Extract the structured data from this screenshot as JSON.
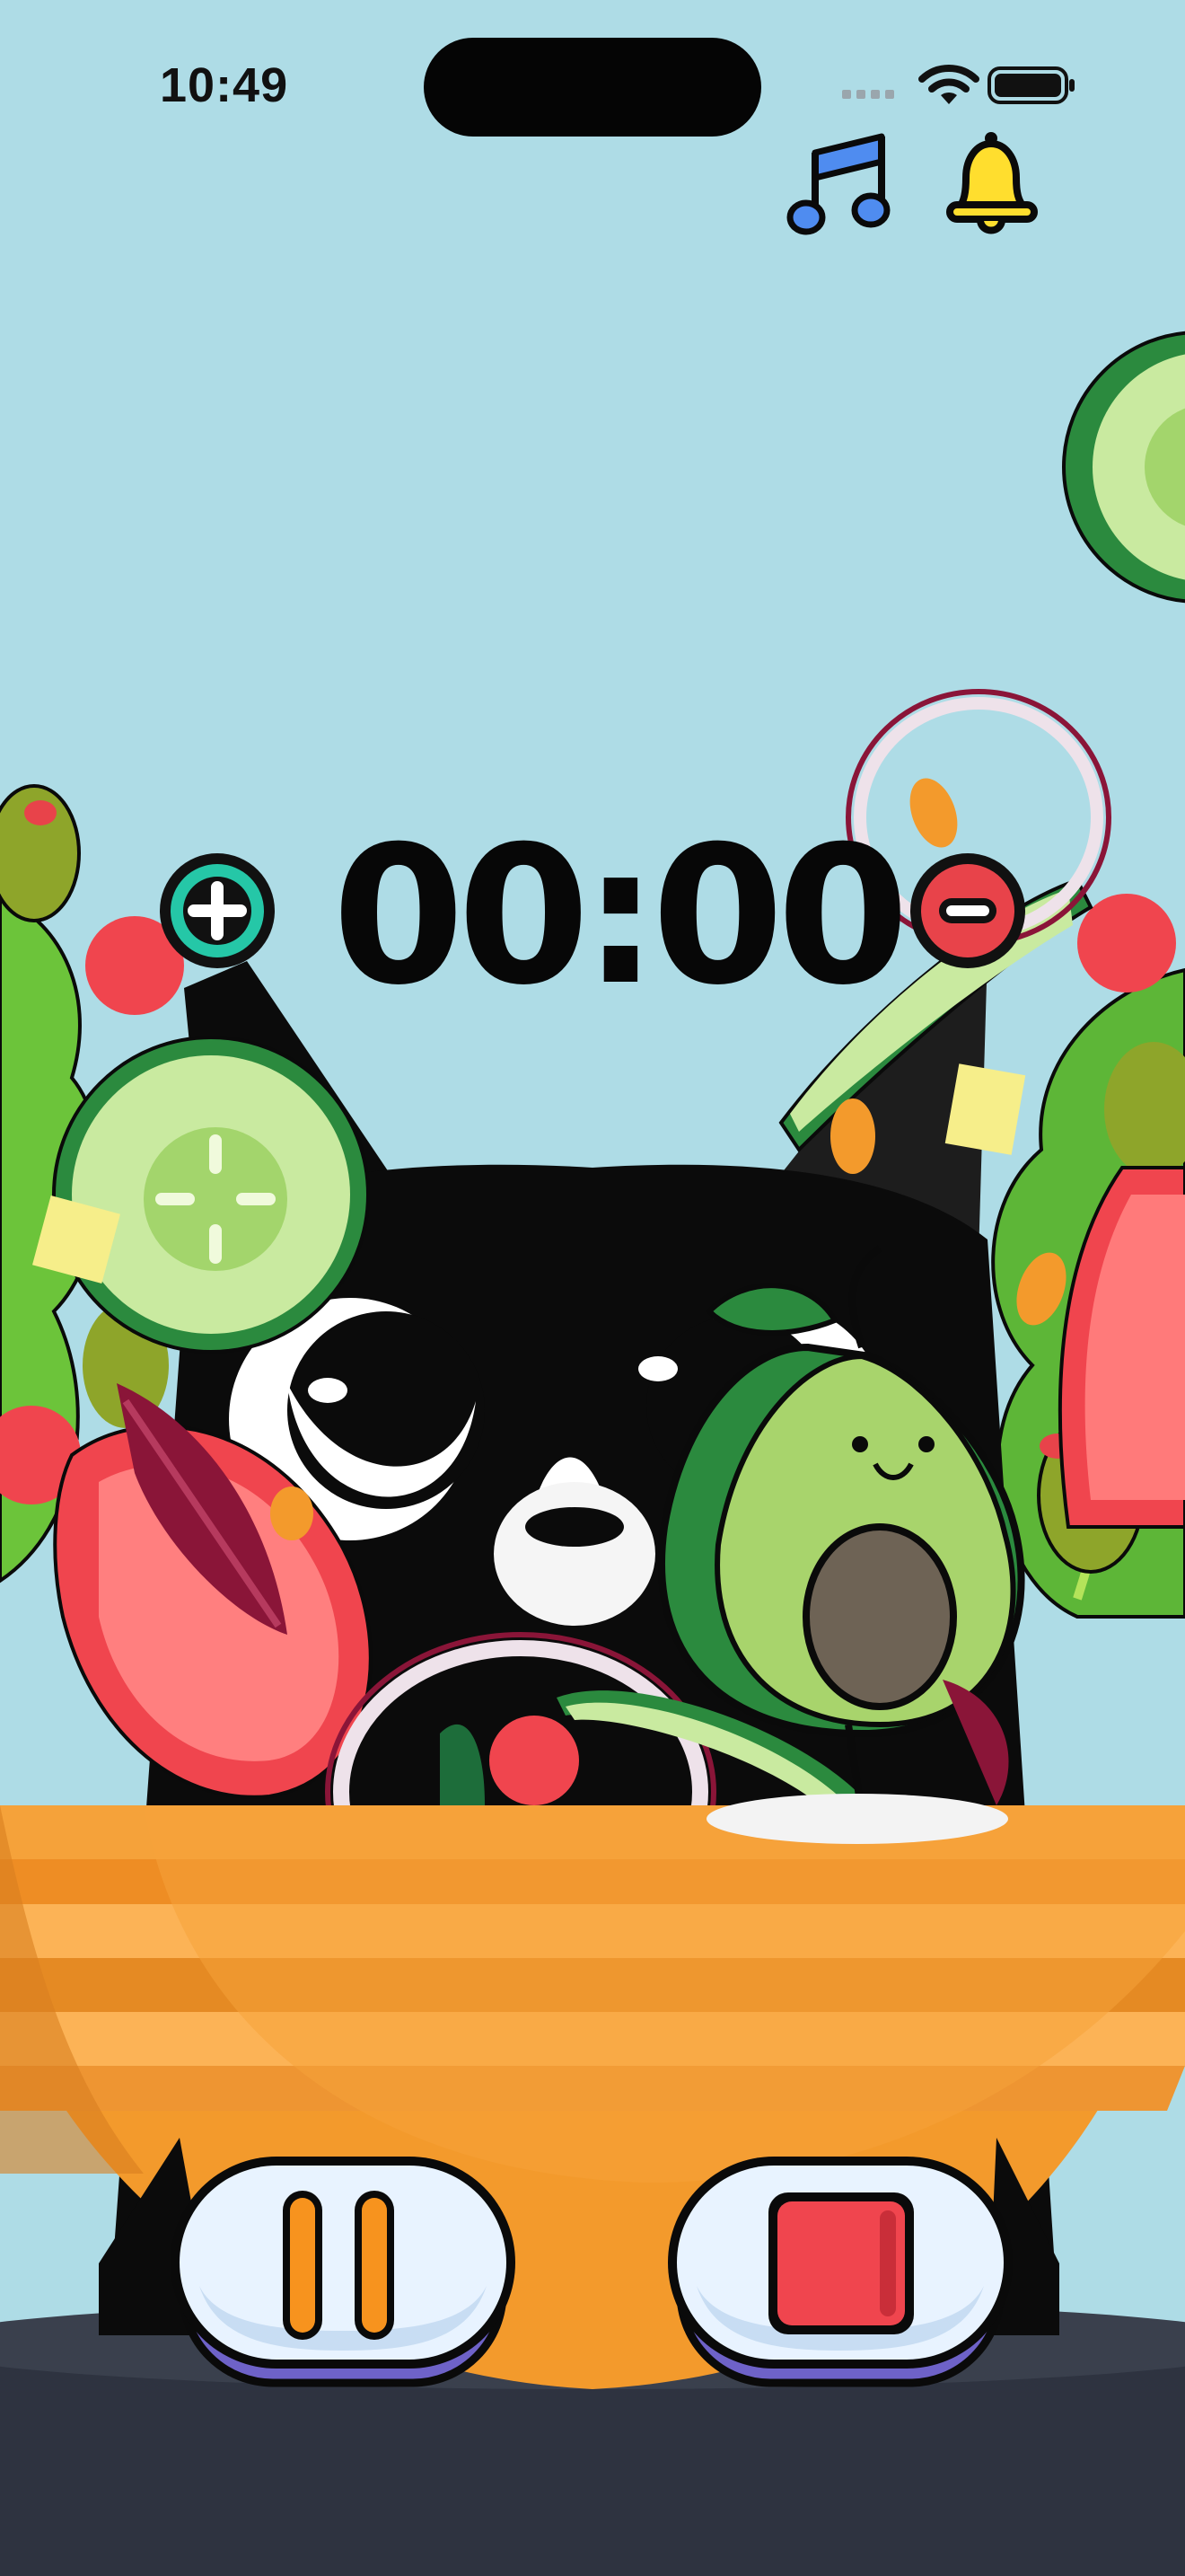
{
  "status_bar": {
    "time": "10:49"
  },
  "timer": {
    "display": "00:00"
  },
  "icons": {
    "music": "music-note-icon",
    "bell": "bell-icon",
    "plus": "plus-icon",
    "minus": "minus-icon",
    "pause": "pause-icon",
    "stop": "stop-icon"
  },
  "colors": {
    "background": "#aedce6",
    "bowl_orange": "#f39a2c",
    "floor": "#2e3340",
    "plus_button": "#25c7a7",
    "minus_button": "#e8434a",
    "stop_square": "#f0454e",
    "pause_bars": "#f7931e",
    "bell": "#ffde2e",
    "music": "#4f8cf0"
  }
}
